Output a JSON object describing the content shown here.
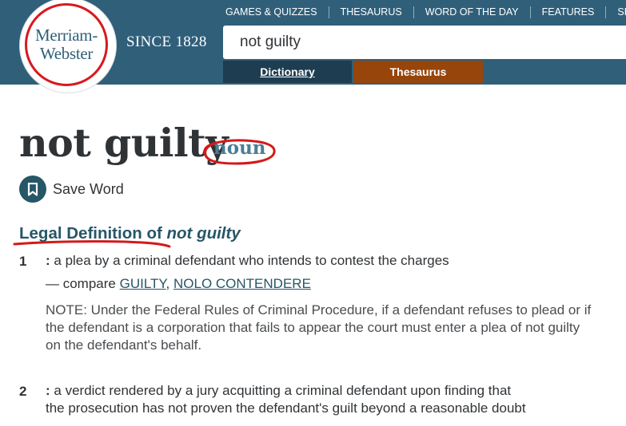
{
  "header": {
    "logo_line1": "Merriam-",
    "logo_line2": "Webster",
    "since": "SINCE 1828",
    "nav": [
      "GAMES & QUIZZES",
      "THESAURUS",
      "WORD OF THE DAY",
      "FEATURES",
      "SHOP"
    ],
    "search_value": "not guilty",
    "tabs": {
      "dictionary": "Dictionary",
      "thesaurus": "Thesaurus"
    }
  },
  "entry": {
    "word": "not guilty",
    "part_of_speech": "noun",
    "save_label": "Save Word",
    "save_icon": "bookmark-icon",
    "section_prefix": "Legal Definition",
    "section_of": " of ",
    "section_word": "not guilty",
    "senses": [
      {
        "num": "1",
        "colon": ":",
        "text": " a plea by a criminal defendant who intends to contest the charges",
        "compare_prefix": "— compare ",
        "compare_links": [
          "GUILTY",
          "NOLO CONTENDERE"
        ],
        "compare_sep": ", ",
        "note": "NOTE: Under the Federal Rules of Criminal Procedure, if a defendant refuses to plead or if the defendant is a corporation that fails to appear the court must enter a plea of not guilty on the defendant's behalf."
      },
      {
        "num": "2",
        "colon": ":",
        "text_line1": " a verdict rendered by a jury acquitting a criminal defendant upon finding that",
        "text_line2": "the prosecution has not proven the defendant's guilt beyond a reasonable doubt"
      }
    ]
  },
  "colors": {
    "header_bg": "#305f7a",
    "dictionary_tab": "#1e3d50",
    "thesaurus_tab": "#97450b",
    "logo_red": "#d71920",
    "annotation_red": "#d21a1a",
    "link_blue": "#265667"
  }
}
